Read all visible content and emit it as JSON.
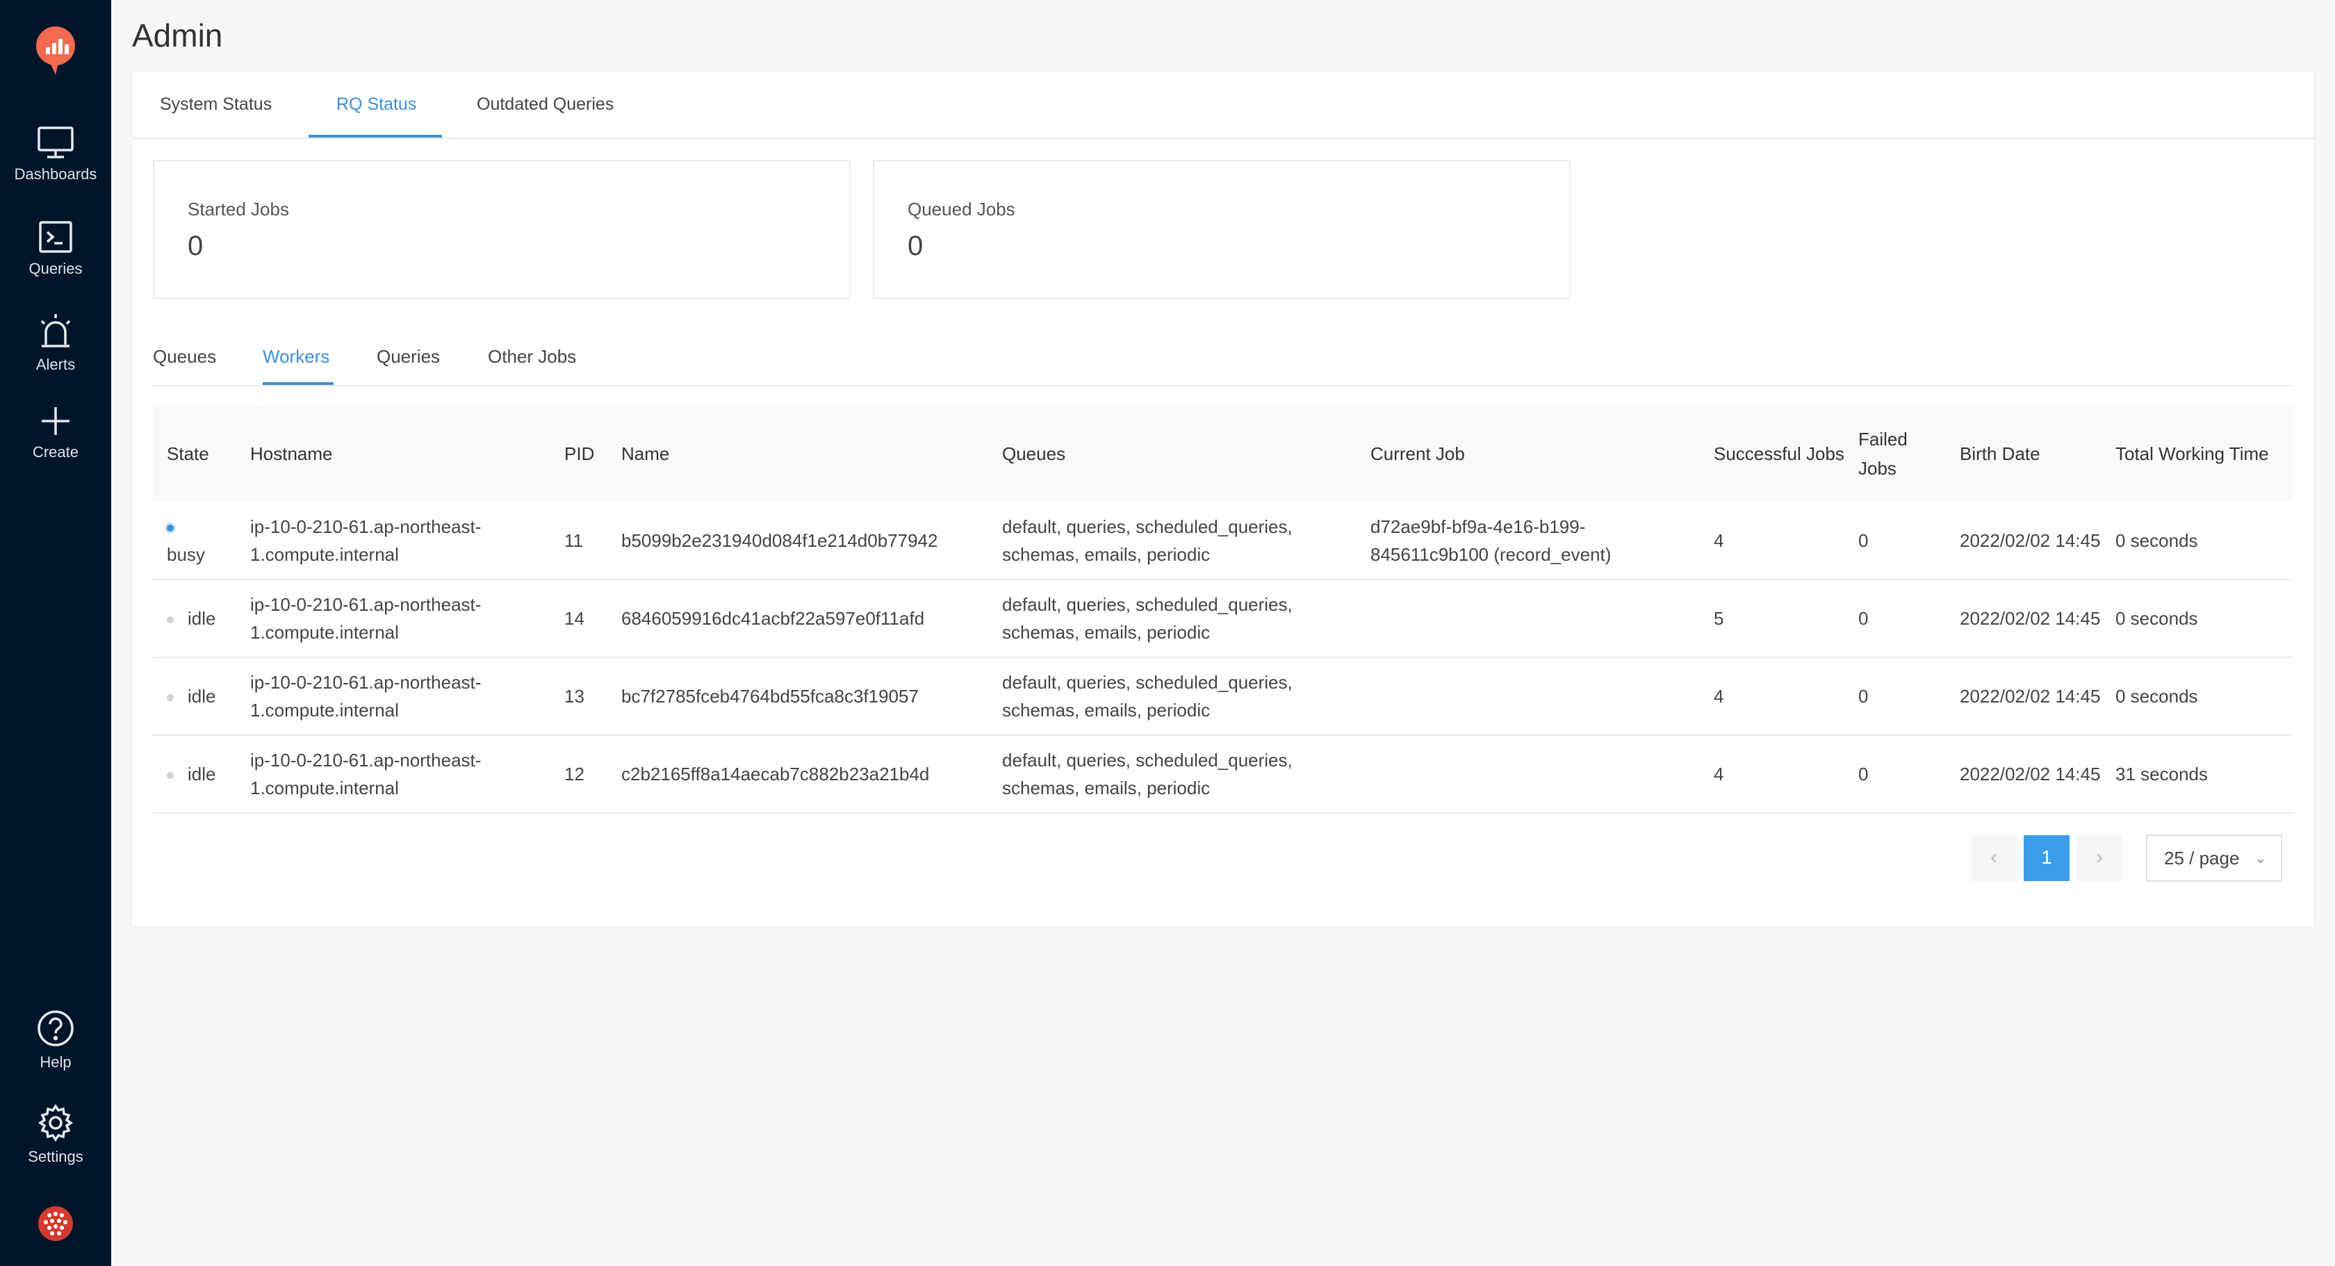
{
  "sidebar": {
    "items": [
      {
        "label": "Dashboards",
        "icon": "monitor-icon"
      },
      {
        "label": "Queries",
        "icon": "terminal-icon"
      },
      {
        "label": "Alerts",
        "icon": "alarm-icon"
      },
      {
        "label": "Create",
        "icon": "plus-icon"
      }
    ],
    "bottom": [
      {
        "label": "Help",
        "icon": "help-icon"
      },
      {
        "label": "Settings",
        "icon": "gear-icon"
      }
    ]
  },
  "page": {
    "title": "Admin"
  },
  "tabs": {
    "items": [
      "System Status",
      "RQ Status",
      "Outdated Queries"
    ],
    "active": "RQ Status"
  },
  "stats": {
    "started_label": "Started Jobs",
    "started_value": "0",
    "queued_label": "Queued Jobs",
    "queued_value": "0"
  },
  "subtabs": {
    "items": [
      "Queues",
      "Workers",
      "Queries",
      "Other Jobs"
    ],
    "active": "Workers"
  },
  "table": {
    "headers": [
      "State",
      "Hostname",
      "PID",
      "Name",
      "Queues",
      "Current Job",
      "Successful Jobs",
      "Failed Jobs",
      "Birth Date",
      "Total Working Time"
    ],
    "rows": [
      {
        "state": "busy",
        "hostname": "ip-10-0-210-61.ap-northeast-1.compute.internal",
        "pid": "11",
        "name": "b5099b2e231940d084f1e214d0b77942",
        "queues": "default, queries, scheduled_queries, schemas, emails, periodic",
        "current_job": "d72ae9bf-bf9a-4e16-b199-845611c9b100 (record_event)",
        "successful": "4",
        "failed": "0",
        "birth": "2022/02/02 14:45",
        "working": "0 seconds"
      },
      {
        "state": "idle",
        "hostname": "ip-10-0-210-61.ap-northeast-1.compute.internal",
        "pid": "14",
        "name": "6846059916dc41acbf22a597e0f11afd",
        "queues": "default, queries, scheduled_queries, schemas, emails, periodic",
        "current_job": "",
        "successful": "5",
        "failed": "0",
        "birth": "2022/02/02 14:45",
        "working": "0 seconds"
      },
      {
        "state": "idle",
        "hostname": "ip-10-0-210-61.ap-northeast-1.compute.internal",
        "pid": "13",
        "name": "bc7f2785fceb4764bd55fca8c3f19057",
        "queues": "default, queries, scheduled_queries, schemas, emails, periodic",
        "current_job": "",
        "successful": "4",
        "failed": "0",
        "birth": "2022/02/02 14:45",
        "working": "0 seconds"
      },
      {
        "state": "idle",
        "hostname": "ip-10-0-210-61.ap-northeast-1.compute.internal",
        "pid": "12",
        "name": "c2b2165ff8a14aecab7c882b23a21b4d",
        "queues": "default, queries, scheduled_queries, schemas, emails, periodic",
        "current_job": "",
        "successful": "4",
        "failed": "0",
        "birth": "2022/02/02 14:45",
        "working": "31 seconds"
      }
    ]
  },
  "pagination": {
    "prev": "‹",
    "current": "1",
    "next": "›",
    "page_size": "25 / page"
  },
  "colors": {
    "sidebar_bg": "#001529",
    "accent": "#3d8fd6",
    "logo": "#f26a50"
  }
}
